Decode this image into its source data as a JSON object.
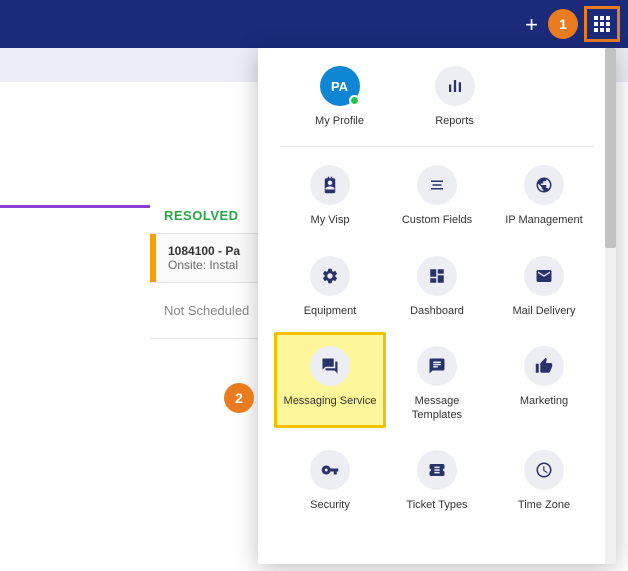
{
  "topbar": {
    "plus": "+",
    "apps_label": "apps"
  },
  "badges": {
    "one": "1",
    "two": "2"
  },
  "resolved": {
    "header": "RESOLVED",
    "ticket_title": "1084100 - Pa",
    "ticket_sub": "Onsite: Instal",
    "empty": "Not Scheduled"
  },
  "profile": {
    "initials": "PA",
    "label": "My Profile"
  },
  "menu": {
    "reports": "Reports",
    "my_visp": "My Visp",
    "custom_fields": "Custom Fields",
    "ip_mgmt": "IP Management",
    "equipment": "Equipment",
    "dashboard": "Dashboard",
    "mail_delivery": "Mail Delivery",
    "messaging_service": "Messaging Service",
    "message_templates": "Message Templates",
    "marketing": "Marketing",
    "security": "Security",
    "ticket_types": "Ticket Types",
    "time_zone": "Time Zone"
  }
}
